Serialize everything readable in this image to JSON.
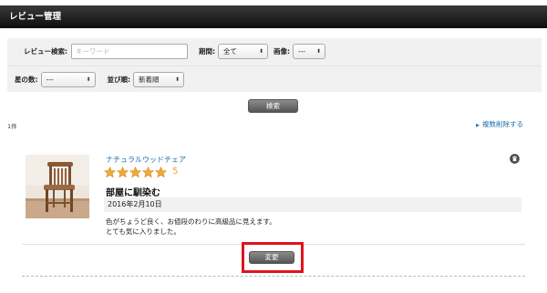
{
  "header": {
    "title": "レビュー管理"
  },
  "filters": {
    "keyword_label": "レビュー検索:",
    "keyword_placeholder": "キーワード",
    "keyword_value": "",
    "period_label": "期間:",
    "period_value": "全て",
    "image_label": "画像:",
    "image_value": "---",
    "stars_label": "星の数:",
    "stars_value": "---",
    "sort_label": "並び順:",
    "sort_value": "新着順"
  },
  "search_button": {
    "label": "検索"
  },
  "results": {
    "count": "1件",
    "bulk_delete": "複数削除する"
  },
  "review": {
    "product_name": "ナチュラルウッドチェア",
    "rating": 5,
    "rating_text": "5",
    "title": "部屋に馴染む",
    "date": "2016年2月10日",
    "body_line1": "色がちょうど良く、お値段のわりに高級品に見えます。",
    "body_line2": "とても気に入りました。",
    "change_button": "変更"
  },
  "colors": {
    "header_bg": "#111111",
    "link": "#1f6fa8",
    "star": "#f2a93b",
    "highlight": "#e0141c",
    "panel_bg": "#f1f1f1"
  },
  "icons": {
    "stars": "star-icon",
    "delete": "trash-icon",
    "dropdown": "chevron-down-icon",
    "bulk_delete": "triangle-right-icon"
  }
}
